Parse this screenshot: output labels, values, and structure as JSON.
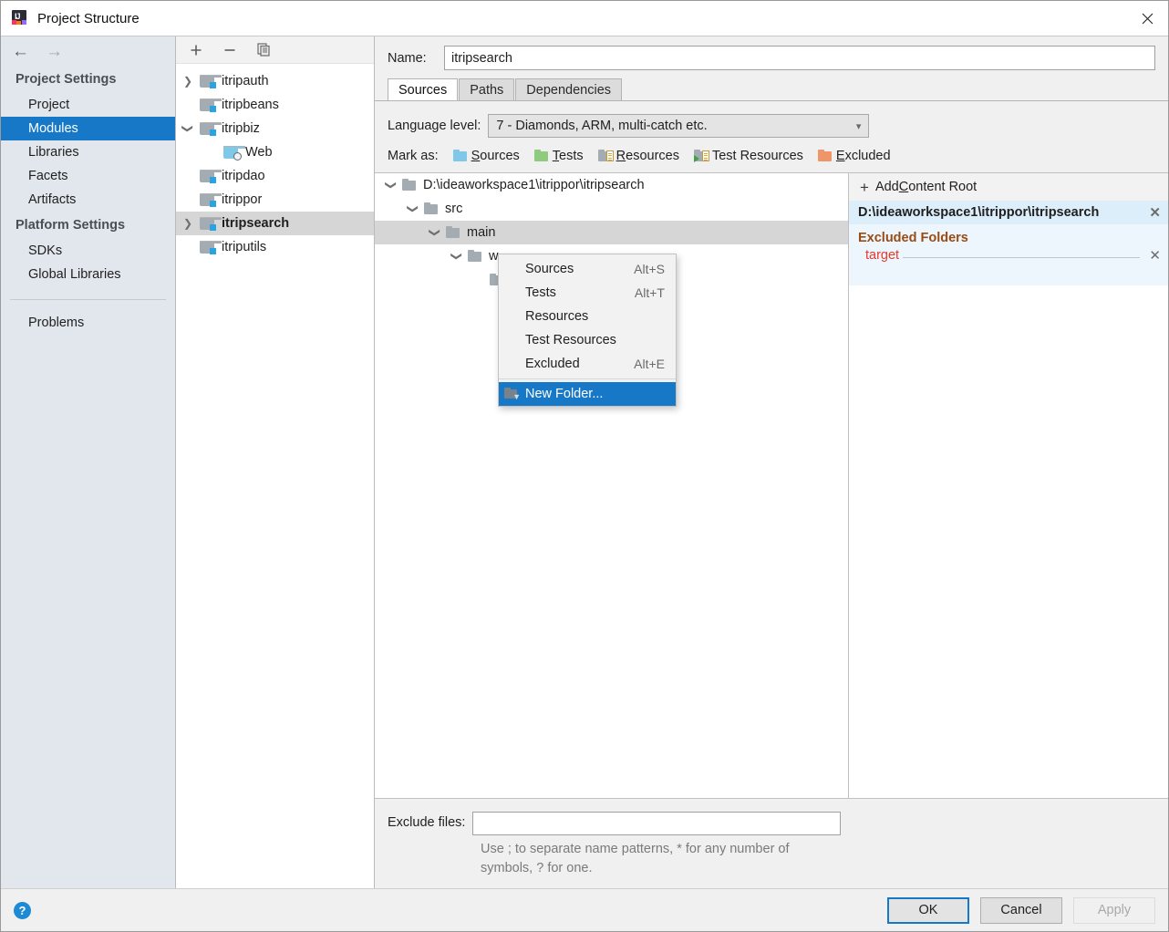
{
  "window": {
    "title": "Project Structure",
    "app_icon": "intellij-idea-icon",
    "close_label": "✕"
  },
  "sidebar": {
    "nav": {
      "back": "←",
      "forward": "→"
    },
    "groups": [
      {
        "title": "Project Settings",
        "items": [
          {
            "label": "Project",
            "selected": false
          },
          {
            "label": "Modules",
            "selected": true
          },
          {
            "label": "Libraries",
            "selected": false
          },
          {
            "label": "Facets",
            "selected": false
          },
          {
            "label": "Artifacts",
            "selected": false
          }
        ]
      },
      {
        "title": "Platform Settings",
        "items": [
          {
            "label": "SDKs",
            "selected": false
          },
          {
            "label": "Global Libraries",
            "selected": false
          }
        ]
      }
    ],
    "problems": {
      "label": "Problems"
    }
  },
  "modules_panel": {
    "toolbar": {
      "add": "+",
      "remove": "−",
      "copy": "copy-icon"
    },
    "tree": [
      {
        "label": "itripauth",
        "indent": 0,
        "twisty": "collapsed",
        "icon": "module-folder-icon",
        "selected": false
      },
      {
        "label": "itripbeans",
        "indent": 0,
        "twisty": "none",
        "icon": "module-folder-icon",
        "selected": false
      },
      {
        "label": "itripbiz",
        "indent": 0,
        "twisty": "expanded",
        "icon": "module-folder-icon",
        "selected": false
      },
      {
        "label": "Web",
        "indent": 1,
        "twisty": "none",
        "icon": "web-facet-icon",
        "selected": false
      },
      {
        "label": "itripdao",
        "indent": 0,
        "twisty": "none",
        "icon": "module-folder-icon",
        "selected": false
      },
      {
        "label": "itrippor",
        "indent": 0,
        "twisty": "none",
        "icon": "module-folder-icon",
        "selected": false
      },
      {
        "label": "itripsearch",
        "indent": 0,
        "twisty": "collapsed",
        "icon": "module-folder-icon",
        "selected": true
      },
      {
        "label": "itriputils",
        "indent": 0,
        "twisty": "none",
        "icon": "module-folder-icon",
        "selected": false
      }
    ]
  },
  "main": {
    "name": {
      "label": "Name:",
      "value": "itripsearch",
      "placeholder": ""
    },
    "tabs": [
      {
        "label": "Sources",
        "active": true
      },
      {
        "label": "Paths",
        "active": false
      },
      {
        "label": "Dependencies",
        "active": false
      }
    ],
    "language_level": {
      "label": "Language level:",
      "value": "7 - Diamonds, ARM, multi-catch etc.",
      "arrow": "⌄"
    },
    "mark_as": {
      "label": "Mark as:",
      "buttons": [
        {
          "mnemonic": "S",
          "rest": "ources",
          "icon": "sources-folder-icon"
        },
        {
          "mnemonic": "T",
          "rest": "ests",
          "icon": "tests-folder-icon"
        },
        {
          "mnemonic": "R",
          "rest": "esources",
          "icon": "resources-folder-icon"
        },
        {
          "mnemonic": "",
          "rest": "Test Resources",
          "icon": "test-resources-folder-icon"
        },
        {
          "mnemonic": "E",
          "rest": "xcluded",
          "icon": "excluded-folder-icon"
        }
      ]
    },
    "content_tree": [
      {
        "label": "D:\\ideaworkspace1\\itrippor\\itripsearch",
        "indent": 0,
        "twisty": "expanded",
        "selected": false
      },
      {
        "label": "src",
        "indent": 1,
        "twisty": "expanded",
        "selected": false
      },
      {
        "label": "main",
        "indent": 2,
        "twisty": "expanded",
        "selected": true
      },
      {
        "label": "w",
        "indent": 3,
        "twisty": "expanded",
        "selected": false
      },
      {
        "label": "",
        "indent": 4,
        "twisty": "none",
        "selected": false
      }
    ],
    "content_roots": {
      "add_label_prefix": "Add ",
      "add_label_mnemonic": "C",
      "add_label_rest": "ontent Root",
      "plus": "+",
      "root_path": "D:\\ideaworkspace1\\itrippor\\itripsearch",
      "root_remove": "✕",
      "excluded_header": "Excluded Folders",
      "excluded_items": [
        {
          "name": "target",
          "remove": "✕"
        }
      ]
    },
    "exclude_files": {
      "label": "Exclude files:",
      "value": "",
      "placeholder": "",
      "hint": "Use ; to separate name patterns, * for any number of symbols, ? for one."
    }
  },
  "context_menu": {
    "items": [
      {
        "label": "Sources",
        "shortcut": "Alt+S",
        "highlighted": false,
        "icon": ""
      },
      {
        "label": "Tests",
        "shortcut": "Alt+T",
        "highlighted": false,
        "icon": ""
      },
      {
        "label": "Resources",
        "shortcut": "",
        "highlighted": false,
        "icon": ""
      },
      {
        "label": "Test Resources",
        "shortcut": "",
        "highlighted": false,
        "icon": ""
      },
      {
        "label": "Excluded",
        "shortcut": "Alt+E",
        "highlighted": false,
        "icon": ""
      },
      {
        "label": "New Folder...",
        "shortcut": "",
        "highlighted": true,
        "icon": "new-folder-icon"
      }
    ]
  },
  "footer": {
    "help": "?",
    "ok": "OK",
    "cancel": "Cancel",
    "apply": "Apply"
  },
  "colors": {
    "accent": "#1878c8",
    "selection_tree": "#d6d6d6",
    "sidebar_bg": "#e1e7ed",
    "excluded_text": "#e8392a",
    "excluded_header": "#9a4b12",
    "root_header_bg": "#ddeefb"
  }
}
